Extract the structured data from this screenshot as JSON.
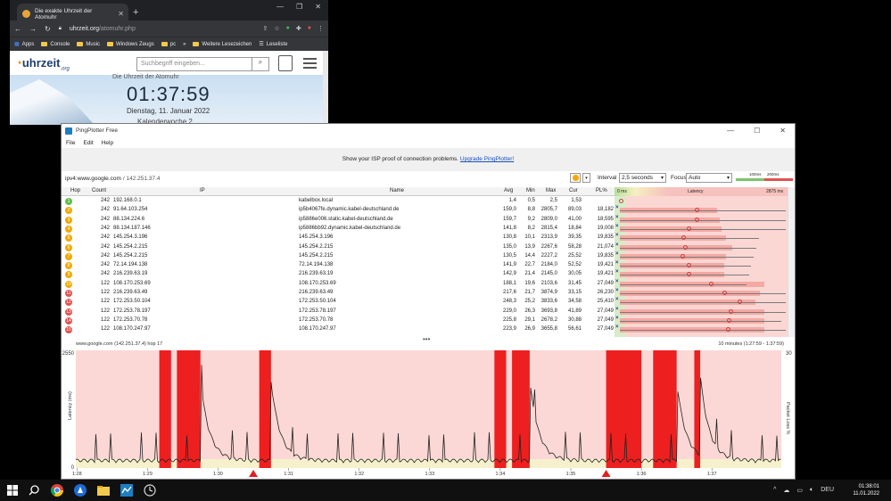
{
  "chrome": {
    "tab_title": "Die exakte Uhrzeit der Atomuhr",
    "url_host": "uhrzeit.org",
    "url_path": "/atomuhr.php",
    "bookmarks": [
      "Apps",
      "Console",
      "Music",
      "Windows Zeugs",
      "pc",
      "»",
      "Weitere Lesezeichen",
      "Leseliste"
    ],
    "site": {
      "logo_main": "uhrzeit",
      "logo_tld": ".org",
      "search_placeholder": "Suchbegriff eingeben...",
      "hero_title": "Die Uhrzeit der Atomuhr",
      "time": "01:37:59",
      "date": "Dienstag, 11. Januar 2022",
      "week": "Kalenderwoche 2"
    }
  },
  "pingplotter": {
    "window_title": "PingPlotter Free",
    "menu": [
      "File",
      "Edit",
      "Help"
    ],
    "banner_text": "Show your ISP proof of connection problems.",
    "banner_link": "Upgrade PingPlotter!",
    "target": "ipv4:www.google.com",
    "target_ip": "/ 142.251.37.4",
    "interval_label": "Interval",
    "interval_value": "2,5 seconds",
    "focus_label": "Focus",
    "focus_value": "Auto",
    "scale_labels": [
      "100ms",
      "200ms"
    ],
    "columns": [
      "Hop",
      "Count",
      "IP",
      "Name",
      "Avg",
      "Min",
      "Max",
      "Cur",
      "PL%",
      "Latency"
    ],
    "latency_axis": [
      "0 ms",
      "2875 ms"
    ],
    "hops": [
      {
        "hop": "1",
        "count": "242",
        "ip": "192.168.0.1",
        "name": "kabelbox.local",
        "avg": "1,4",
        "min": "0,5",
        "max": "2,5",
        "cur": "1,53",
        "pl": "",
        "color": "#5fbf4a"
      },
      {
        "hop": "2",
        "count": "242",
        "ip": "91.64.103.254",
        "name": "ip5b4067fe.dynamic.kabel-deutschland.de",
        "avg": "159,0",
        "min": "8,8",
        "max": "2805,7",
        "cur": "89,03",
        "pl": "18,182",
        "color": "#f2a900"
      },
      {
        "hop": "3",
        "count": "242",
        "ip": "88.134.224.6",
        "name": "ip5886e006.static.kabel-deutschland.de",
        "avg": "159,7",
        "min": "9,2",
        "max": "2809,0",
        "cur": "41,00",
        "pl": "18,595",
        "color": "#f2a900"
      },
      {
        "hop": "4",
        "count": "242",
        "ip": "88.134.187.146",
        "name": "ip5886bb92.dynamic.kabel-deutschland.de",
        "avg": "141,8",
        "min": "8,2",
        "max": "2815,4",
        "cur": "18,84",
        "pl": "19,008",
        "color": "#f2a900"
      },
      {
        "hop": "5",
        "count": "242",
        "ip": "145.254.3.196",
        "name": "145.254.3.196",
        "avg": "130,8",
        "min": "10,1",
        "max": "2313,9",
        "cur": "39,35",
        "pl": "19,835",
        "color": "#f2a900"
      },
      {
        "hop": "6",
        "count": "242",
        "ip": "145.254.2.215",
        "name": "145.254.2.215",
        "avg": "135,0",
        "min": "13,9",
        "max": "2267,6",
        "cur": "58,28",
        "pl": "21,074",
        "color": "#f2a900"
      },
      {
        "hop": "7",
        "count": "242",
        "ip": "145.254.2.215",
        "name": "145.254.2.215",
        "avg": "130,5",
        "min": "14,4",
        "max": "2227,2",
        "cur": "25,52",
        "pl": "19,835",
        "color": "#f2a900"
      },
      {
        "hop": "8",
        "count": "242",
        "ip": "72.14.194.138",
        "name": "72.14.194.138",
        "avg": "141,9",
        "min": "22,7",
        "max": "2184,0",
        "cur": "52,52",
        "pl": "19,421",
        "color": "#f2a900"
      },
      {
        "hop": "9",
        "count": "242",
        "ip": "216.239.63.19",
        "name": "216.239.63.19",
        "avg": "142,9",
        "min": "21,4",
        "max": "2145,0",
        "cur": "30,05",
        "pl": "19,421",
        "color": "#f2a900"
      },
      {
        "hop": "10",
        "count": "122",
        "ip": "108.170.253.69",
        "name": "108.170.253.69",
        "avg": "188,1",
        "min": "19,6",
        "max": "2103,6",
        "cur": "31,45",
        "pl": "27,049",
        "color": "#f2a900"
      },
      {
        "hop": "11",
        "count": "122",
        "ip": "216.239.63.49",
        "name": "216.239.63.49",
        "avg": "217,6",
        "min": "21,7",
        "max": "3874,9",
        "cur": "33,15",
        "pl": "26,230",
        "color": "#e0524f"
      },
      {
        "hop": "12",
        "count": "122",
        "ip": "172.253.50.104",
        "name": "172.253.50.104",
        "avg": "248,3",
        "min": "25,2",
        "max": "3833,6",
        "cur": "34,58",
        "pl": "25,410",
        "color": "#e0524f"
      },
      {
        "hop": "13",
        "count": "122",
        "ip": "172.253.78.197",
        "name": "172.253.78.197",
        "avg": "229,0",
        "min": "26,3",
        "max": "3693,8",
        "cur": "41,89",
        "pl": "27,049",
        "color": "#e0524f"
      },
      {
        "hop": "14",
        "count": "122",
        "ip": "172.253.70.78",
        "name": "172.253.70.78",
        "avg": "225,8",
        "min": "29,1",
        "max": "2678,2",
        "cur": "30,88",
        "pl": "27,049",
        "color": "#e0524f"
      },
      {
        "hop": "15",
        "count": "122",
        "ip": "108.170.247.97",
        "name": "108.170.247.97",
        "avg": "223,9",
        "min": "26,9",
        "max": "3655,8",
        "cur": "56,61",
        "pl": "27,049",
        "color": "#e0524f"
      }
    ],
    "graph": {
      "title": "www.google.com (142.251.37.4) hop 17",
      "range": "10 minutes (1:27:59 - 1:37:59)",
      "y_left_top": "2550",
      "y_left_bottom": "0",
      "y_right_top": "30",
      "y_left_label": "Latency (ms)",
      "y_right_label": "Packet Loss %",
      "x_ticks": [
        "1:28",
        "1:29",
        "1:30",
        "1:31",
        "1:32",
        "1:33",
        "1:34",
        "1:35",
        "1:36",
        "1:37"
      ]
    }
  },
  "chart_data": {
    "type": "area",
    "title": "www.google.com (142.251.37.4) hop 17",
    "xlabel": "",
    "ylabel": "Latency (ms)",
    "y2label": "Packet Loss %",
    "ylim": [
      0,
      2550
    ],
    "y2lim": [
      0,
      30
    ],
    "x": [
      "1:28",
      "1:29",
      "1:30",
      "1:31",
      "1:32",
      "1:33",
      "1:34",
      "1:35",
      "1:36",
      "1:37"
    ],
    "packet_loss_periods": [
      [
        "1:29:10",
        "1:29:20"
      ],
      [
        "1:29:25",
        "1:29:45"
      ],
      [
        "1:30:35",
        "1:30:45"
      ],
      [
        "1:33:55",
        "1:34:05"
      ],
      [
        "1:34:10",
        "1:34:25"
      ],
      [
        "1:35:30",
        "1:36:00"
      ],
      [
        "1:36:10",
        "1:36:30"
      ],
      [
        "1:36:45",
        "1:36:50"
      ]
    ],
    "loss_markers": [
      "1:30:30",
      "1:35:30"
    ]
  },
  "taskbar": {
    "time": "01:38:01",
    "date": "11.01.2022",
    "lang": "DEU"
  }
}
